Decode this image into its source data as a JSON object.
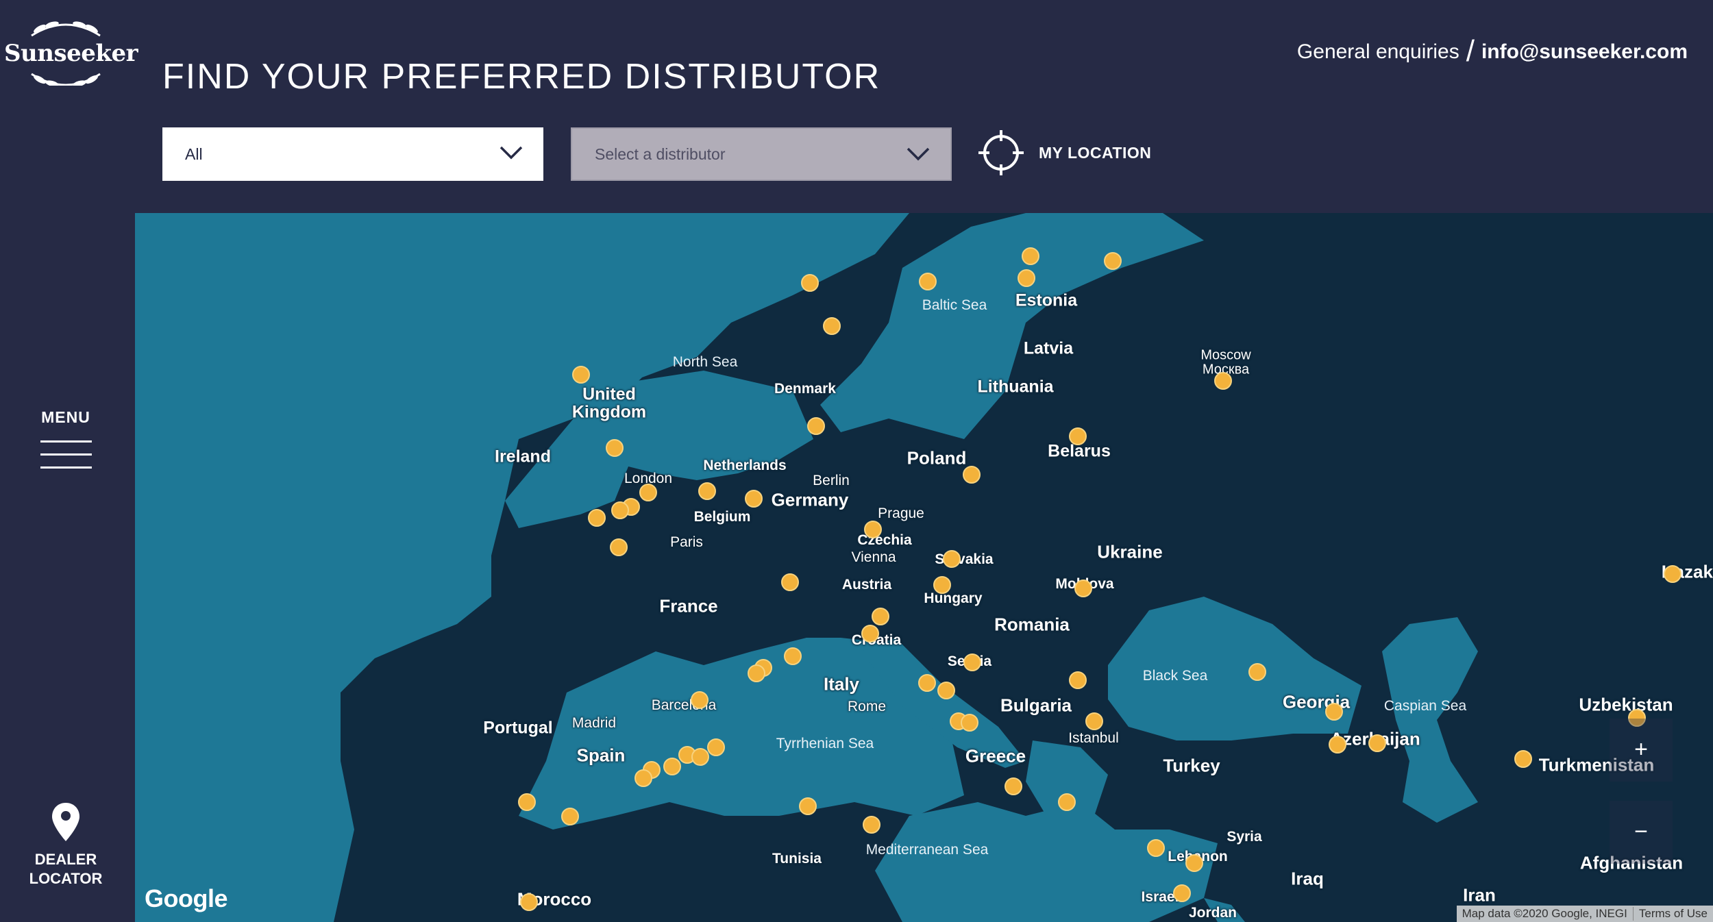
{
  "brand": {
    "logo_text": "Sunseeker"
  },
  "sidebar": {
    "menu_label": "MENU",
    "dealer_label_line1": "DEALER",
    "dealer_label_line2": "LOCATOR"
  },
  "header": {
    "title": "FIND YOUR PREFERRED DISTRIBUTOR",
    "enquiries_label": "General enquiries",
    "enquiries_separator": "/",
    "email": "info@sunseeker.com"
  },
  "filters": {
    "region_select": {
      "value": "All"
    },
    "distributor_select": {
      "placeholder": "Select a distributor"
    },
    "my_location_label": "MY LOCATION"
  },
  "map": {
    "google_logo": "Google",
    "attribution": "Map data ©2020 Google, INEGI",
    "terms": "Terms of Use",
    "zoom_in": "+",
    "zoom_out": "−",
    "labels": [
      {
        "text": "Estonia",
        "cls": "country"
      },
      {
        "text": "Latvia",
        "cls": "country"
      },
      {
        "text": "Lithuania",
        "cls": "country"
      },
      {
        "text": "Baltic Sea",
        "cls": "sea"
      },
      {
        "text": "North Sea",
        "cls": "sea"
      },
      {
        "text": "Denmark",
        "cls": "country"
      },
      {
        "text": "United",
        "cls": "country"
      },
      {
        "text": "Kingdom",
        "cls": "country"
      },
      {
        "text": "Ireland",
        "cls": "country"
      },
      {
        "text": "London",
        "cls": "city"
      },
      {
        "text": "Netherlands",
        "cls": "country"
      },
      {
        "text": "Berlin",
        "cls": "city"
      },
      {
        "text": "Germany",
        "cls": "country"
      },
      {
        "text": "Belgium",
        "cls": "country"
      },
      {
        "text": "Poland",
        "cls": "country"
      },
      {
        "text": "Belarus",
        "cls": "country"
      },
      {
        "text": "Moscow",
        "cls": "city"
      },
      {
        "text": "Москва",
        "cls": "city"
      },
      {
        "text": "Paris",
        "cls": "city"
      },
      {
        "text": "Prague",
        "cls": "city"
      },
      {
        "text": "Czechia",
        "cls": "country"
      },
      {
        "text": "Vienna",
        "cls": "city"
      },
      {
        "text": "Slovakia",
        "cls": "country"
      },
      {
        "text": "Ukraine",
        "cls": "country"
      },
      {
        "text": "Austria",
        "cls": "country"
      },
      {
        "text": "Hungary",
        "cls": "country"
      },
      {
        "text": "Moldova",
        "cls": "country"
      },
      {
        "text": "France",
        "cls": "country"
      },
      {
        "text": "Romania",
        "cls": "country"
      },
      {
        "text": "Croatia",
        "cls": "country"
      },
      {
        "text": "Serbia",
        "cls": "country"
      },
      {
        "text": "Italy",
        "cls": "country"
      },
      {
        "text": "Rome",
        "cls": "city"
      },
      {
        "text": "Bulgaria",
        "cls": "country"
      },
      {
        "text": "Black Sea",
        "cls": "sea"
      },
      {
        "text": "Georgia",
        "cls": "country"
      },
      {
        "text": "Caspian Sea",
        "cls": "sea"
      },
      {
        "text": "Barcelona",
        "cls": "city"
      },
      {
        "text": "Madrid",
        "cls": "city"
      },
      {
        "text": "Portugal",
        "cls": "country"
      },
      {
        "text": "Spain",
        "cls": "country"
      },
      {
        "text": "Tyrrhenian Sea",
        "cls": "sea"
      },
      {
        "text": "Istanbul",
        "cls": "city"
      },
      {
        "text": "Greece",
        "cls": "country"
      },
      {
        "text": "Turkey",
        "cls": "country"
      },
      {
        "text": "Azerbaijan",
        "cls": "country"
      },
      {
        "text": "Uzbekistan",
        "cls": "country"
      },
      {
        "text": "Turkmenistan",
        "cls": "country"
      },
      {
        "text": "Kazakhstan",
        "cls": "country"
      },
      {
        "text": "Tunisia",
        "cls": "country"
      },
      {
        "text": "Mediterranean Sea",
        "cls": "sea"
      },
      {
        "text": "Syria",
        "cls": "country"
      },
      {
        "text": "Lebanon",
        "cls": "country"
      },
      {
        "text": "Iraq",
        "cls": "country"
      },
      {
        "text": "Afghanistan",
        "cls": "country"
      },
      {
        "text": "Morocco",
        "cls": "country"
      },
      {
        "text": "Israel",
        "cls": "country"
      },
      {
        "text": "Jordan",
        "cls": "country"
      },
      {
        "text": "Iran",
        "cls": "country"
      }
    ]
  }
}
